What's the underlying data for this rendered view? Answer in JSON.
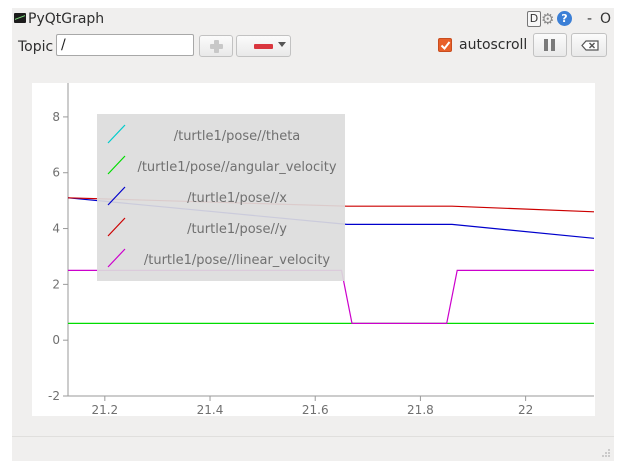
{
  "window": {
    "title": "PyQtGraph",
    "d_label": "D",
    "help_label": "?",
    "minimize_label": "-",
    "close_label": "O"
  },
  "toolbar": {
    "topic_label": "Topic",
    "topic_value": "/",
    "autoscroll_label": "autoscroll",
    "autoscroll_checked": true
  },
  "colors": {
    "theta": "#00cccc",
    "angular_velocity": "#00dd00",
    "x": "#0000cc",
    "y": "#cc0000",
    "linear_velocity": "#cc00cc",
    "remove_button": "#d9363e",
    "checkbox": "#e8602a",
    "legend_background": "#dcdcdc"
  },
  "chart_data": {
    "type": "line",
    "xlim": [
      21.13,
      22.13
    ],
    "ylim": [
      -2,
      9
    ],
    "xticks": [
      21.2,
      21.4,
      21.6,
      21.8,
      22
    ],
    "xtick_labels": [
      "21.2",
      "21.4",
      "21.6",
      "21.8",
      "22"
    ],
    "yticks": [
      -2,
      0,
      2,
      4,
      6,
      8
    ],
    "ytick_labels": [
      "-2",
      "0",
      "2",
      "4",
      "6",
      "8"
    ],
    "grid": false,
    "legend_position": "top-left",
    "series": [
      {
        "name": "/turtle1/pose//theta",
        "color": "#00cccc",
        "x": [],
        "y": []
      },
      {
        "name": "/turtle1/pose//angular_velocity",
        "color": "#00dd00",
        "x": [
          21.13,
          22.13
        ],
        "y": [
          0.6,
          0.6
        ]
      },
      {
        "name": "/turtle1/pose//x",
        "color": "#0000cc",
        "x": [
          21.13,
          21.66,
          21.86,
          22.13
        ],
        "y": [
          5.1,
          4.15,
          4.15,
          3.65
        ]
      },
      {
        "name": "/turtle1/pose//y",
        "color": "#cc0000",
        "x": [
          21.13,
          21.66,
          21.86,
          22.13
        ],
        "y": [
          5.1,
          4.8,
          4.8,
          4.6
        ]
      },
      {
        "name": "/turtle1/pose//linear_velocity",
        "color": "#cc00cc",
        "x": [
          21.13,
          21.65,
          21.67,
          21.85,
          21.87,
          22.13
        ],
        "y": [
          2.5,
          2.5,
          0.6,
          0.6,
          2.5,
          2.5
        ]
      }
    ]
  }
}
